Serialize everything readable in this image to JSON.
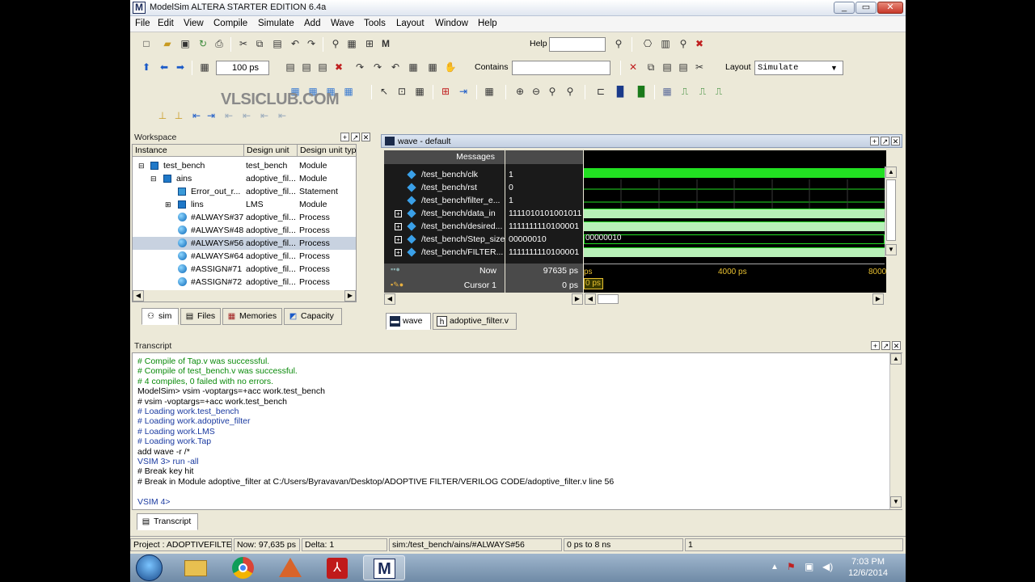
{
  "window": {
    "title": "ModelSim ALTERA STARTER EDITION 6.4a",
    "logo": "M",
    "minimize": "_",
    "maximize": "▭",
    "close": "✕"
  },
  "menu": [
    "File",
    "Edit",
    "View",
    "Compile",
    "Simulate",
    "Add",
    "Wave",
    "Tools",
    "Layout",
    "Window",
    "Help"
  ],
  "toolbar": {
    "help_label": "Help",
    "help_value": "",
    "time_value": "100 ps",
    "contains_label": "Contains",
    "contains_value": "",
    "layout_label": "Layout",
    "layout_value": "Simulate"
  },
  "watermark": "VLSICLUB.COM",
  "workspace": {
    "title": "Workspace",
    "columns": [
      "Instance",
      "Design unit",
      "Design unit type"
    ],
    "rows": [
      {
        "instance": "test_bench",
        "unit": "test_bench",
        "type": "Module"
      },
      {
        "instance": "ains",
        "unit": "adoptive_fil...",
        "type": "Module"
      },
      {
        "instance": "Error_out_r...",
        "unit": "adoptive_fil...",
        "type": "Statement"
      },
      {
        "instance": "lins",
        "unit": "LMS",
        "type": "Module"
      },
      {
        "instance": "#ALWAYS#37",
        "unit": "adoptive_fil...",
        "type": "Process"
      },
      {
        "instance": "#ALWAYS#48",
        "unit": "adoptive_fil...",
        "type": "Process"
      },
      {
        "instance": "#ALWAYS#56",
        "unit": "adoptive_fil...",
        "type": "Process"
      },
      {
        "instance": "#ALWAYS#64",
        "unit": "adoptive_fil...",
        "type": "Process"
      },
      {
        "instance": "#ASSIGN#71",
        "unit": "adoptive_fil...",
        "type": "Process"
      },
      {
        "instance": "#ASSIGN#72",
        "unit": "adoptive_fil...",
        "type": "Process"
      }
    ],
    "tabs": [
      "sim",
      "Files",
      "Memories",
      "Capacity"
    ]
  },
  "wave": {
    "title": "wave - default",
    "messages_label": "Messages",
    "signals": [
      {
        "name": "/test_bench/clk",
        "value": "1",
        "expandable": false
      },
      {
        "name": "/test_bench/rst",
        "value": "0",
        "expandable": false
      },
      {
        "name": "/test_bench/filter_e...",
        "value": "1",
        "expandable": false
      },
      {
        "name": "/test_bench/data_in",
        "value": "1111010101001011",
        "expandable": true
      },
      {
        "name": "/test_bench/desired...",
        "value": "1111111110100001",
        "expandable": true
      },
      {
        "name": "/test_bench/Step_size",
        "value": "00000010",
        "expandable": true
      },
      {
        "name": "/test_bench/FILTER...",
        "value": "1111111110100001",
        "expandable": true
      }
    ],
    "wave_label_step": "00000010",
    "now_label": "Now",
    "now_value": "97635 ps",
    "cursor_label": "Cursor 1",
    "cursor_value": "0 ps",
    "cursor_marker": "0 ps",
    "ruler": [
      "ps",
      "4000 ps",
      "8000"
    ],
    "tabs": [
      "wave",
      "adoptive_filter.v"
    ]
  },
  "transcript": {
    "title": "Transcript",
    "lines": [
      {
        "text": "# Compile of Tap.v was successful.",
        "kind": "green"
      },
      {
        "text": "# Compile of test_bench.v was successful.",
        "kind": "green"
      },
      {
        "text": "# 4 compiles, 0 failed with no errors.",
        "kind": "green"
      },
      {
        "text": "ModelSim> vsim -voptargs=+acc work.test_bench",
        "kind": "black"
      },
      {
        "text": "# vsim -voptargs=+acc work.test_bench",
        "kind": "black"
      },
      {
        "text": "# Loading work.test_bench",
        "kind": "blue"
      },
      {
        "text": "# Loading work.adoptive_filter",
        "kind": "blue"
      },
      {
        "text": "# Loading work.LMS",
        "kind": "blue"
      },
      {
        "text": "# Loading work.Tap",
        "kind": "blue"
      },
      {
        "text": "add wave -r /*",
        "kind": "black"
      },
      {
        "text": "VSIM 3> run -all",
        "kind": "blue"
      },
      {
        "text": "# Break key hit",
        "kind": "black"
      },
      {
        "text": "# Break in Module adoptive_filter at C:/Users/Byravavan/Desktop/ADOPTIVE FILTER/VERILOG CODE/adoptive_filter.v line 56",
        "kind": "black"
      },
      {
        "text": "",
        "kind": "black"
      },
      {
        "text": "VSIM 4>",
        "kind": "blue"
      }
    ],
    "tab": "Transcript"
  },
  "status": {
    "project": "Project : ADOPTIVEFILTER",
    "now": "Now: 97,635 ps",
    "delta": "Delta: 1",
    "path": "sim:/test_bench/ains/#ALWAYS#56",
    "range": "0 ps to 8 ns",
    "field": "1"
  },
  "taskbar": {
    "time": "7:03 PM",
    "date": "12/6/2014"
  }
}
